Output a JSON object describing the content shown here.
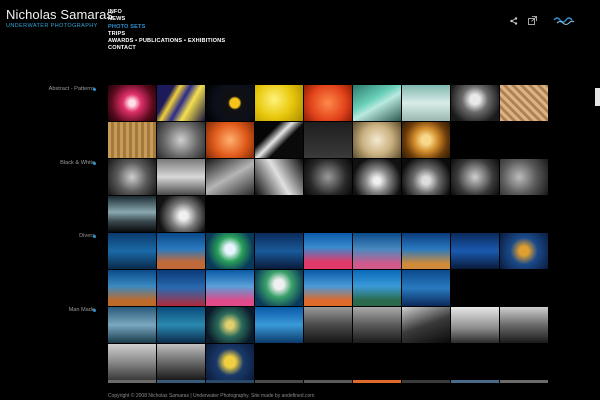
{
  "brand": {
    "name": "Nicholas Samaras",
    "subtitle": "UNDERWATER PHOTOGRAPHY"
  },
  "nav": [
    "INFO",
    "NEWS",
    "PHOTO SETS",
    "TRIPS",
    "AWARDS • PUBLICATIONS • EXHIBITIONS",
    "CONTACT"
  ],
  "nav_active": "PHOTO SETS",
  "icons": [
    "share-icon",
    "external-link-icon",
    "waves-logo-icon"
  ],
  "accent_color": "#2f8fd0",
  "categories": [
    {
      "label": "Abstract - Patterns"
    },
    {
      "label": "Black & White"
    },
    {
      "label": "Divers"
    },
    {
      "label": "Man Made"
    }
  ],
  "footer": "Copyright © 2008 Nicholas Samaras | Underwater Photography. Site made by andefined.com"
}
